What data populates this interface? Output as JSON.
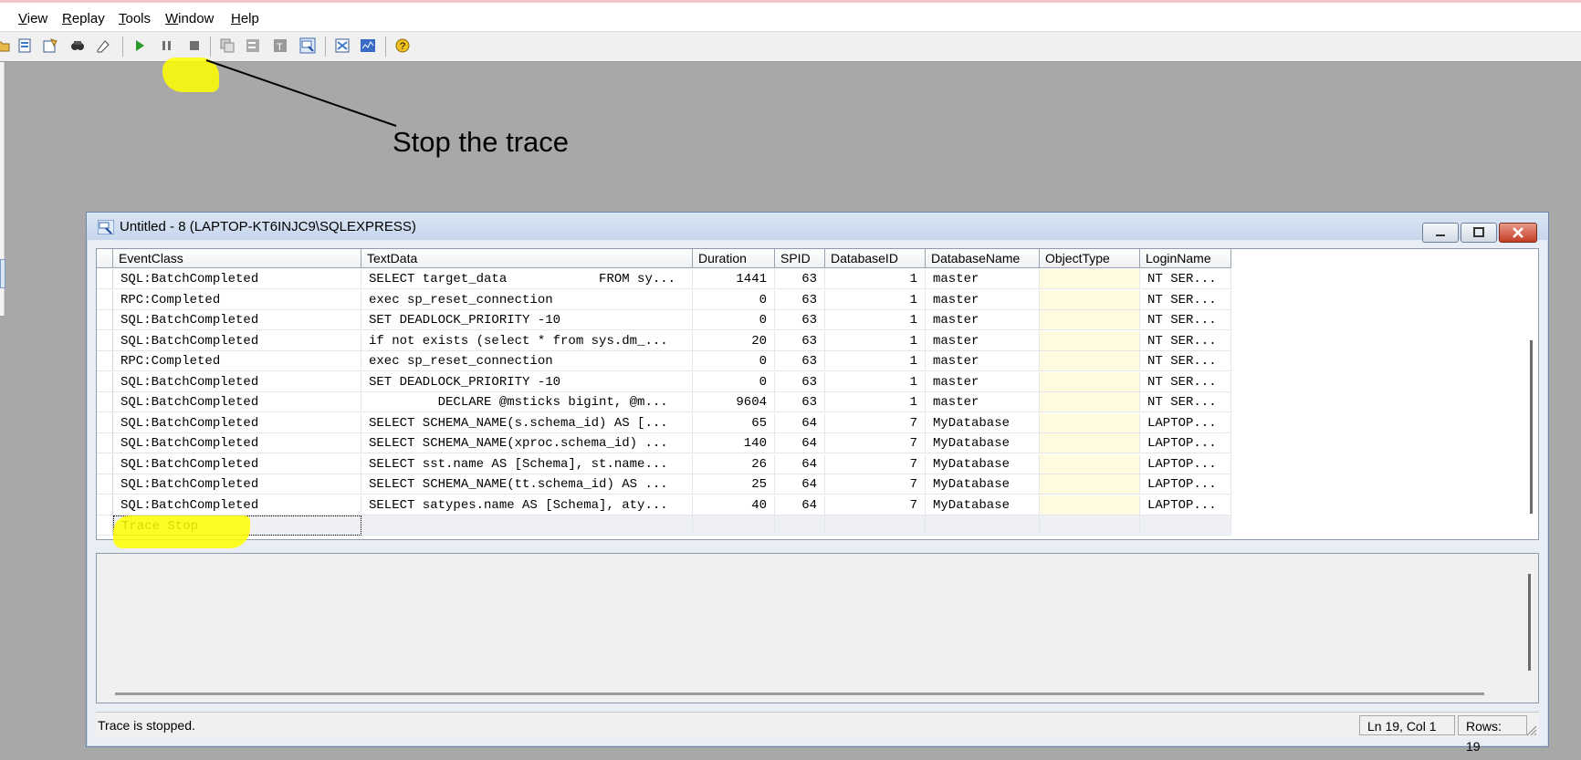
{
  "menu": {
    "items": [
      {
        "label": "View",
        "accel": "V",
        "rest": "iew"
      },
      {
        "label": "Replay",
        "accel": "R",
        "rest": "eplay"
      },
      {
        "label": "Tools",
        "accel": "T",
        "rest": "ools"
      },
      {
        "label": "Window",
        "accel": "W",
        "rest": "indow"
      },
      {
        "label": "Help",
        "accel": "H",
        "rest": "elp"
      }
    ]
  },
  "toolbar": {
    "icons": [
      "open-icon",
      "properties-icon",
      "template-icon",
      "find-icon",
      "eraser-icon",
      "run-icon",
      "pause-icon",
      "stop-icon",
      "auto-scroll-icon",
      "clear-icon",
      "column-icon",
      "trace-window-icon",
      "profiler-icon",
      "activity-monitor-icon",
      "help-icon"
    ]
  },
  "annotation": {
    "text": "Stop the trace"
  },
  "window": {
    "title": "Untitled - 8 (LAPTOP-KT6INJC9\\SQLEXPRESS)",
    "columns": [
      "EventClass",
      "TextData",
      "Duration",
      "SPID",
      "DatabaseID",
      "DatabaseName",
      "ObjectType",
      "LoginName"
    ],
    "rows": [
      {
        "event": "SQL:BatchCompleted",
        "text": "SELECT target_data            FROM sy...",
        "duration": "1441",
        "spid": "63",
        "dbid": "1",
        "dbname": "master",
        "objtype": "",
        "login": "NT SER..."
      },
      {
        "event": "RPC:Completed",
        "text": "exec sp_reset_connection",
        "duration": "0",
        "spid": "63",
        "dbid": "1",
        "dbname": "master",
        "objtype": "",
        "login": "NT SER..."
      },
      {
        "event": "SQL:BatchCompleted",
        "text": "SET DEADLOCK_PRIORITY -10",
        "duration": "0",
        "spid": "63",
        "dbid": "1",
        "dbname": "master",
        "objtype": "",
        "login": "NT SER..."
      },
      {
        "event": "SQL:BatchCompleted",
        "text": "if not exists (select * from sys.dm_...",
        "duration": "20",
        "spid": "63",
        "dbid": "1",
        "dbname": "master",
        "objtype": "",
        "login": "NT SER..."
      },
      {
        "event": "RPC:Completed",
        "text": "exec sp_reset_connection",
        "duration": "0",
        "spid": "63",
        "dbid": "1",
        "dbname": "master",
        "objtype": "",
        "login": "NT SER..."
      },
      {
        "event": "SQL:BatchCompleted",
        "text": "SET DEADLOCK_PRIORITY -10",
        "duration": "0",
        "spid": "63",
        "dbid": "1",
        "dbname": "master",
        "objtype": "",
        "login": "NT SER..."
      },
      {
        "event": "SQL:BatchCompleted",
        "text": "         DECLARE @msticks bigint, @m...",
        "duration": "9604",
        "spid": "63",
        "dbid": "1",
        "dbname": "master",
        "objtype": "",
        "login": "NT SER..."
      },
      {
        "event": "SQL:BatchCompleted",
        "text": "SELECT SCHEMA_NAME(s.schema_id) AS [...",
        "duration": "65",
        "spid": "64",
        "dbid": "7",
        "dbname": "MyDatabase",
        "objtype": "",
        "login": "LAPTOP..."
      },
      {
        "event": "SQL:BatchCompleted",
        "text": "SELECT SCHEMA_NAME(xproc.schema_id) ...",
        "duration": "140",
        "spid": "64",
        "dbid": "7",
        "dbname": "MyDatabase",
        "objtype": "",
        "login": "LAPTOP..."
      },
      {
        "event": "SQL:BatchCompleted",
        "text": "SELECT sst.name AS [Schema], st.name...",
        "duration": "26",
        "spid": "64",
        "dbid": "7",
        "dbname": "MyDatabase",
        "objtype": "",
        "login": "LAPTOP..."
      },
      {
        "event": "SQL:BatchCompleted",
        "text": "SELECT SCHEMA_NAME(tt.schema_id) AS ...",
        "duration": "25",
        "spid": "64",
        "dbid": "7",
        "dbname": "MyDatabase",
        "objtype": "",
        "login": "LAPTOP..."
      },
      {
        "event": "SQL:BatchCompleted",
        "text": "SELECT satypes.name AS [Schema], aty...",
        "duration": "40",
        "spid": "64",
        "dbid": "7",
        "dbname": "MyDatabase",
        "objtype": "",
        "login": "LAPTOP..."
      },
      {
        "event": "Trace Stop",
        "text": "",
        "duration": "",
        "spid": "",
        "dbid": "",
        "dbname": "",
        "objtype": "",
        "login": ""
      }
    ]
  },
  "status": {
    "message": "Trace is stopped.",
    "position": "Ln 19, Col 1",
    "rows": "Rows: 19"
  },
  "colors": {
    "highlight": "#ffff00",
    "objtype_bg": "#fffbe0",
    "desktop": "#a8a8a8"
  }
}
